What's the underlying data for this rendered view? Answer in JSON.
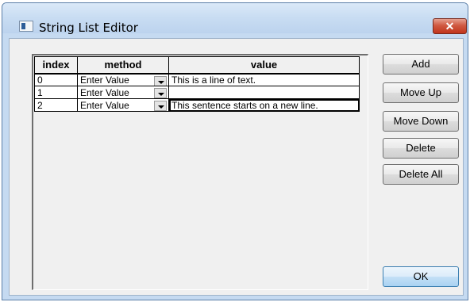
{
  "window": {
    "title": "String List Editor",
    "close_glyph": "✕",
    "icon": "app-window-icon"
  },
  "grid": {
    "columns": [
      "index",
      "method",
      "value"
    ],
    "rows": [
      {
        "index": "0",
        "method": "Enter Value",
        "value": "This is a line of text."
      },
      {
        "index": "1",
        "method": "Enter Value",
        "value": ""
      },
      {
        "index": "2",
        "method": "Enter Value",
        "value": "This sentence starts on a new line."
      }
    ]
  },
  "buttons": {
    "add": "Add",
    "move_up": "Move Up",
    "move_down": "Move Down",
    "delete": "Delete",
    "delete_all": "Delete All",
    "ok": "OK"
  },
  "colors": {
    "titlebar": "#c8dcf2",
    "close": "#c1351c",
    "ok_accent": "#3c7fb1"
  }
}
